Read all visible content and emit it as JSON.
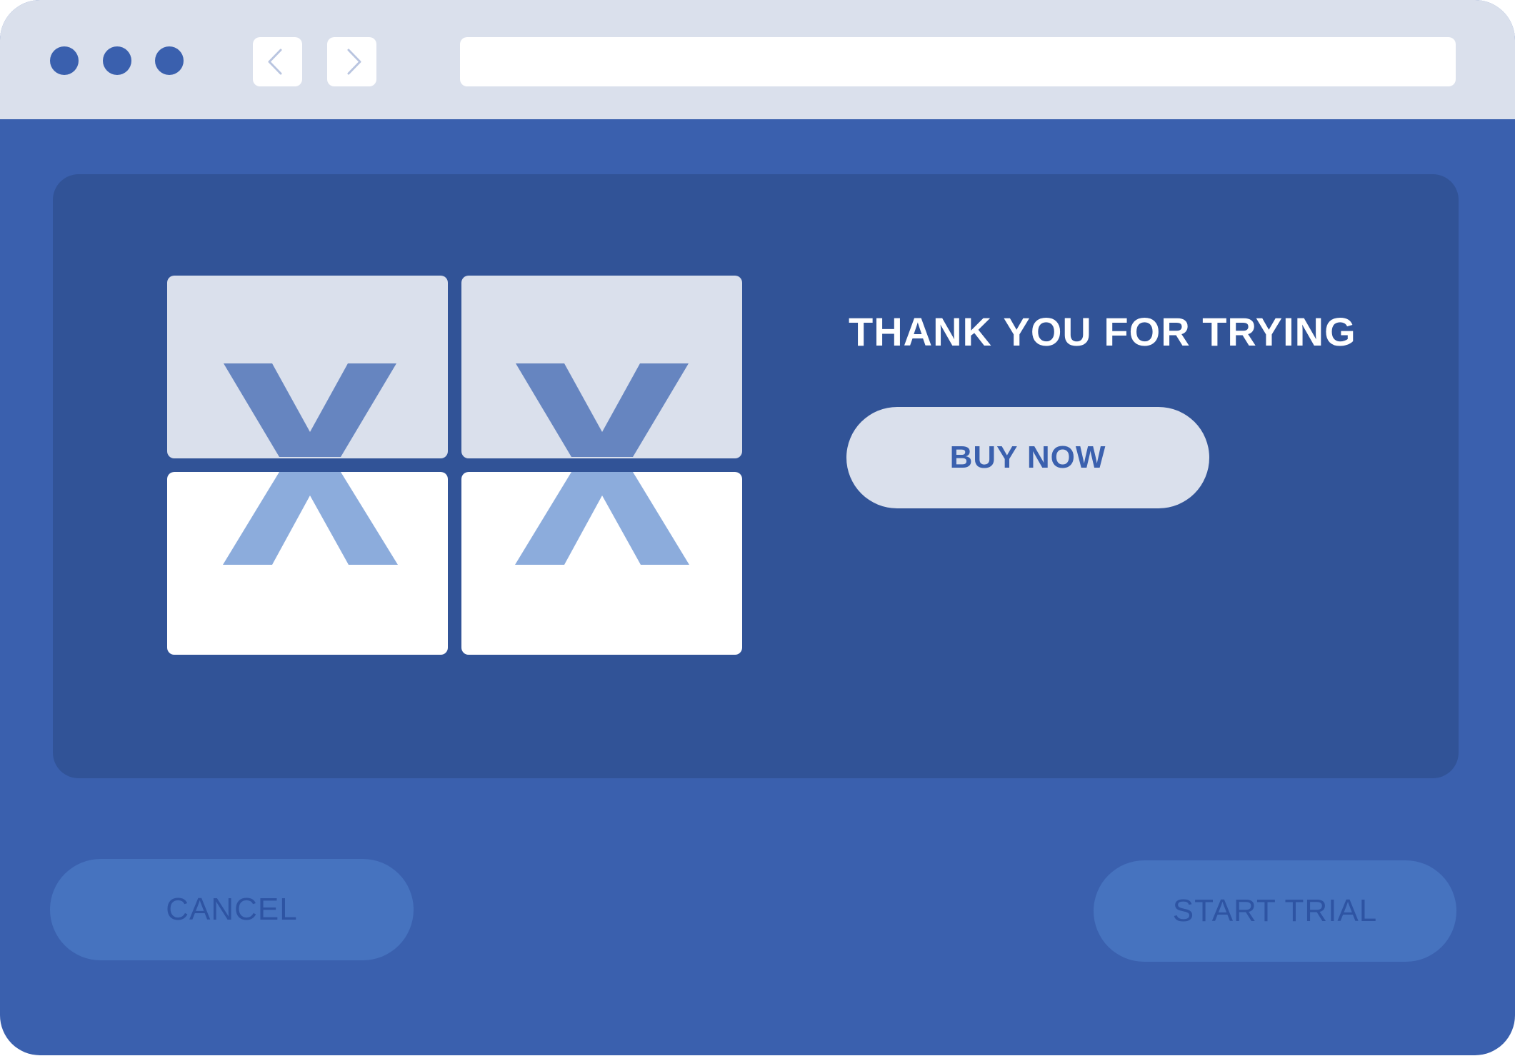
{
  "colors": {
    "window_bg": "#3a60ae",
    "titlebar_bg": "#dae0ec",
    "panel_bg": "#315397",
    "window_dots": "#3a60ae",
    "nav_chevron": "#b9c5e0",
    "tile_light": "#dae0ec",
    "tile_white": "#ffffff",
    "logo_dark": "#6685c0",
    "logo_light": "#8cacdc",
    "headline_text": "#ffffff",
    "buy_bg": "#dae0ec",
    "buy_text": "#3a60ae",
    "secondary_bg": "#4673bf",
    "secondary_text": "#2e54a3"
  },
  "browser": {
    "window_controls": [
      "window-dot-1",
      "window-dot-2",
      "window-dot-3"
    ],
    "back_icon": "chevron-left-icon",
    "forward_icon": "chevron-right-icon",
    "address": ""
  },
  "promo": {
    "logo_icon": "x-tiles-logo-icon",
    "headline": "THANK YOU FOR TRYING",
    "buy_label": "BUY NOW"
  },
  "footer": {
    "cancel_label": "CANCEL",
    "start_trial_label": "START TRIAL"
  }
}
